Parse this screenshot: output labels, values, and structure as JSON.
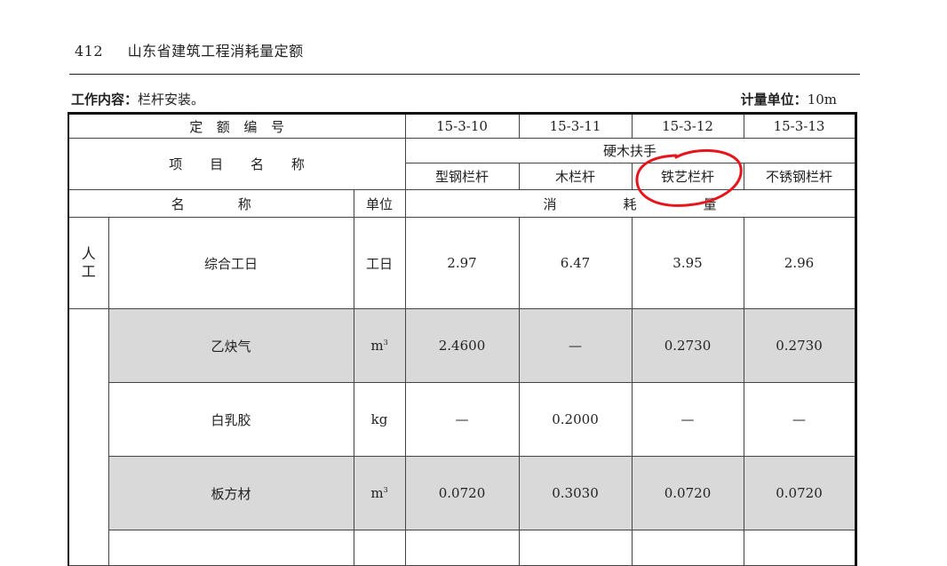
{
  "header": {
    "page_number": "412",
    "book_title": "山东省建筑工程消耗量定额"
  },
  "work_content": {
    "label": "工作内容：",
    "value": "栏杆安装。"
  },
  "unit_info": {
    "label": "计量单位：",
    "value": "10m"
  },
  "table": {
    "quota_number_label": "定　额　编　号",
    "codes": [
      "15-3-10",
      "15-3-11",
      "15-3-12",
      "15-3-13"
    ],
    "item_name_label": "项　　目　　名　　称",
    "group_label": "硬木扶手",
    "items": [
      "型钢栏杆",
      "木栏杆",
      "铁艺栏杆",
      "不锈钢栏杆"
    ],
    "name_header": "名　　　　称",
    "unit_header": "单位",
    "consumption_header": "消　　　　　耗　　　　　量",
    "labor_category": [
      "人",
      "工"
    ],
    "rows": [
      {
        "name": "综合工日",
        "unit": "工日",
        "values": [
          "2.97",
          "6.47",
          "3.95",
          "2.96"
        ]
      },
      {
        "name": "乙炔气",
        "unit_base": "m",
        "unit_sup": "3",
        "values": [
          "2.4600",
          "—",
          "0.2730",
          "0.2730"
        ]
      },
      {
        "name": "白乳胶",
        "unit": "kg",
        "values": [
          "—",
          "0.2000",
          "—",
          "—"
        ]
      },
      {
        "name": "板方材",
        "unit_base": "m",
        "unit_sup": "3",
        "values": [
          "0.0720",
          "0.3030",
          "0.0720",
          "0.0720"
        ]
      }
    ]
  },
  "annotation": {
    "color": "#e8141c"
  }
}
